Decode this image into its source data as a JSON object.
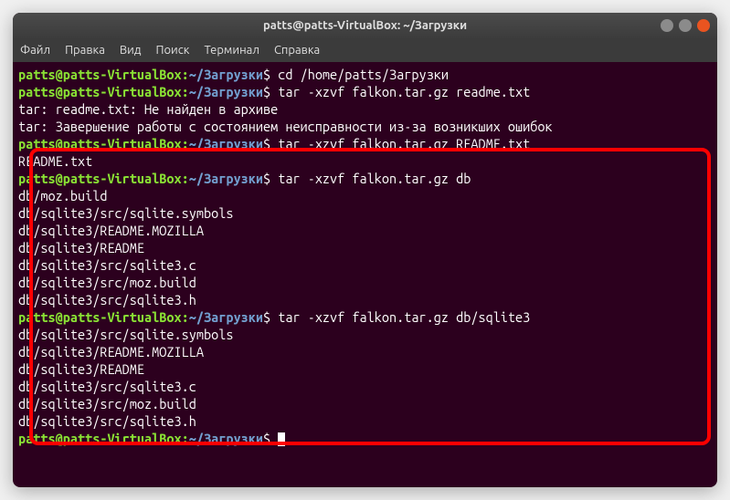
{
  "window": {
    "title": "patts@patts-VirtualBox: ~/Загрузки"
  },
  "menu": {
    "file": "Файл",
    "edit": "Правка",
    "view": "Вид",
    "search": "Поиск",
    "terminal": "Терминал",
    "help": "Справка"
  },
  "prompt": {
    "user_host": "patts@patts-VirtualBox",
    "separator": ":",
    "path": "~/Загрузки",
    "dollar": "$"
  },
  "lines": {
    "l1_cmd": " cd /home/patts/Загрузки",
    "l2_cmd": " tar -xzvf falkon.tar.gz readme.txt",
    "l3": "tar: readme.txt: Не найден в архиве",
    "l4": "tar: Завершение работы с состоянием неисправности из-за возникших ошибок",
    "l5_cmd": " tar -xzvf falkon.tar.gz README.txt",
    "l6": "README.txt",
    "l7_cmd": " tar -xzvf falkon.tar.gz db",
    "l8": "db/moz.build",
    "l9": "db/sqlite3/src/sqlite.symbols",
    "l10": "db/sqlite3/README.MOZILLA",
    "l11": "db/sqlite3/README",
    "l12": "db/sqlite3/src/sqlite3.c",
    "l13": "db/sqlite3/src/moz.build",
    "l14": "db/sqlite3/src/sqlite3.h",
    "l15_cmd": " tar -xzvf falkon.tar.gz db/sqlite3",
    "l16": "db/sqlite3/src/sqlite.symbols",
    "l17": "db/sqlite3/README.MOZILLA",
    "l18": "db/sqlite3/README",
    "l19": "db/sqlite3/src/sqlite3.c",
    "l20": "db/sqlite3/src/moz.build",
    "l21": "db/sqlite3/src/sqlite3.h",
    "l22_cmd": " "
  }
}
